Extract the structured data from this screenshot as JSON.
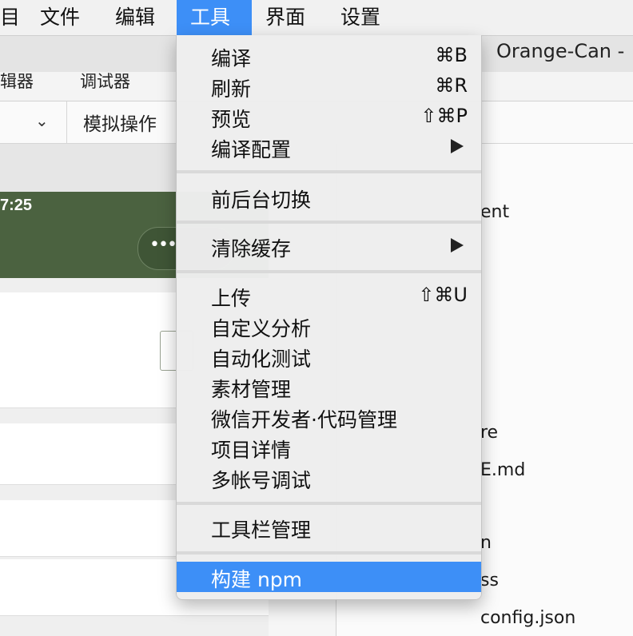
{
  "menubar": {
    "items": [
      "目",
      "文件",
      "编辑",
      "工具",
      "界面",
      "设置"
    ],
    "active_index": 3
  },
  "window": {
    "title": "Orange-Can -",
    "tab_labels": [
      "辑器",
      "调试器"
    ],
    "toolbar_text": "模拟操作",
    "sim_time": "7:25"
  },
  "file_list": [
    "ent",
    "re",
    "E.md",
    "n",
    "ss",
    "config.json"
  ],
  "dropdown": {
    "groups": [
      [
        {
          "label": "编译",
          "shortcut": "⌘B"
        },
        {
          "label": "刷新",
          "shortcut": "⌘R"
        },
        {
          "label": "预览",
          "shortcut": "⇧⌘P"
        },
        {
          "label": "编译配置",
          "submenu": true
        }
      ],
      [
        {
          "label": "前后台切换"
        }
      ],
      [
        {
          "label": "清除缓存",
          "submenu": true
        }
      ],
      [
        {
          "label": "上传",
          "shortcut": "⇧⌘U"
        },
        {
          "label": "自定义分析"
        },
        {
          "label": "自动化测试"
        },
        {
          "label": "素材管理"
        },
        {
          "label": "微信开发者·代码管理"
        },
        {
          "label": "项目详情"
        },
        {
          "label": "多帐号调试"
        }
      ],
      [
        {
          "label": "工具栏管理"
        }
      ],
      [
        {
          "label": "构建 npm",
          "highlighted": true
        }
      ]
    ]
  },
  "colors": {
    "accent": "#3d8ff7",
    "header_green": "#4b6240"
  },
  "icons": {
    "submenu_arrow": "triangle-right-icon",
    "chevron": "chevron-down-icon",
    "more": "more-dots-icon"
  }
}
